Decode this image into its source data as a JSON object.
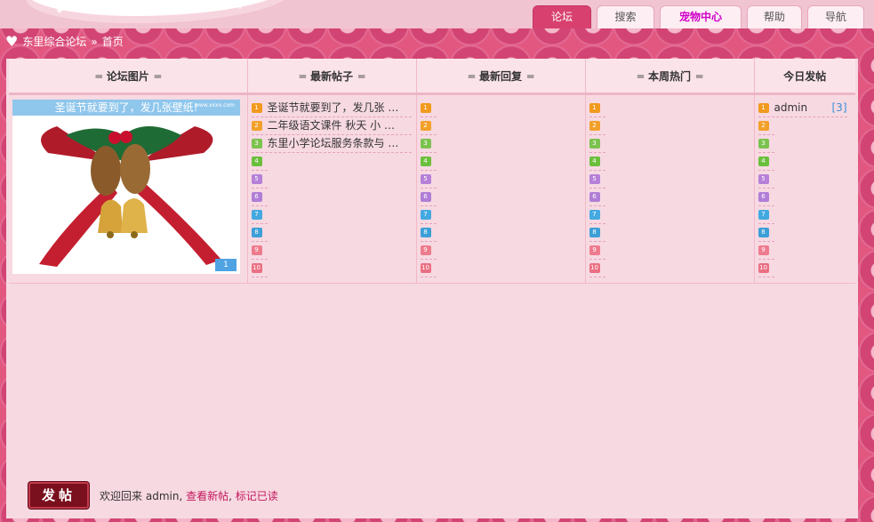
{
  "nav": {
    "tabs": [
      "论坛",
      "搜索",
      "宠物中心",
      "帮助",
      "导航"
    ]
  },
  "breadcrumb": {
    "forum": "东里综合论坛",
    "separator": "»",
    "page": "首页"
  },
  "headers": {
    "pictures": "论坛图片",
    "latest_posts": "最新帖子",
    "latest_replies": "最新回复",
    "weekly_hot": "本周热门",
    "today_posts": "今日发帖"
  },
  "picture": {
    "caption": "圣诞节就要到了，发几张壁纸!",
    "site_mark": "www.xxxx.com",
    "next_label": "1"
  },
  "latest_posts": [
    "圣诞节就要到了，发几张 …",
    "二年级语文课件 秋天 小 …",
    "东里小学论坛服务条款与 …",
    "",
    "",
    "",
    "",
    "",
    "",
    ""
  ],
  "rank_numbers": [
    "1",
    "2",
    "3",
    "4",
    "5",
    "6",
    "7",
    "8",
    "9",
    "10"
  ],
  "today": {
    "user": "admin",
    "count": "[3]"
  },
  "footer": {
    "post_button": "发帖",
    "welcome": "欢迎回来",
    "user": "admin",
    "view_new": "查看新帖",
    "mark_read": "标记已读",
    "comma": ","
  },
  "colors": {
    "accent": "#d8416f",
    "panel_bg": "#f7d9e2",
    "link": "#c2185b",
    "pet_center": "#d000c8"
  }
}
